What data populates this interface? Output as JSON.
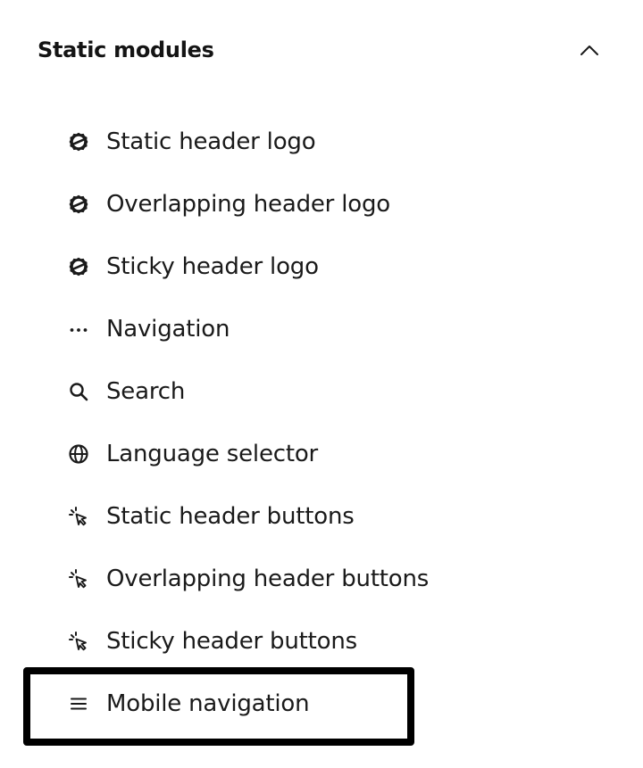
{
  "section": {
    "title": "Static modules",
    "chevron_icon": "chevron-up-icon",
    "expanded": true
  },
  "modules": [
    {
      "label": "Static header logo",
      "icon": "logo-icon"
    },
    {
      "label": "Overlapping header logo",
      "icon": "logo-icon"
    },
    {
      "label": "Sticky header logo",
      "icon": "logo-icon"
    },
    {
      "label": "Navigation",
      "icon": "more-horizontal-icon"
    },
    {
      "label": "Search",
      "icon": "search-icon"
    },
    {
      "label": "Language selector",
      "icon": "globe-icon"
    },
    {
      "label": "Static header buttons",
      "icon": "click-cursor-icon"
    },
    {
      "label": "Overlapping header buttons",
      "icon": "click-cursor-icon"
    },
    {
      "label": "Sticky header buttons",
      "icon": "click-cursor-icon"
    },
    {
      "label": "Mobile navigation",
      "icon": "hamburger-menu-icon",
      "highlighted": true
    }
  ],
  "colors": {
    "text": "#1a1a1a",
    "highlight_border": "#000000",
    "background": "#ffffff"
  }
}
